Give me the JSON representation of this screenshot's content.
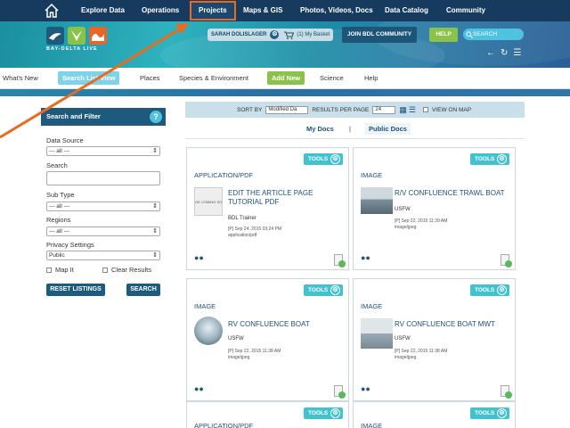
{
  "top_nav": {
    "items": [
      "Explore Data",
      "Operations",
      "Projects",
      "Maps & GIS",
      "Photos, Videos, Docs",
      "Data Catalog",
      "Community"
    ],
    "active": "Projects"
  },
  "header": {
    "logo_text": "BAY-DELTA LIVE",
    "user_name": "SARAH DOLISLAGER",
    "basket": "(1) My Basket",
    "community_button": "JOIN BDL COMMUNITY",
    "help_button": "HELP",
    "search_placeholder": "SEARCH"
  },
  "sub_nav": {
    "items": [
      "What's New",
      "Search List View",
      "Places",
      "Species & Environment",
      "Add New",
      "Science",
      "Help"
    ]
  },
  "sidebar": {
    "title": "Search and Filter",
    "help_glyph": "?",
    "data_source_label": "Data Source",
    "data_source_value": "--- all ---",
    "search_label": "Search",
    "search_value": "",
    "subtype_label": "Sub Type",
    "subtype_value": "--- all ---",
    "regions_label": "Regions",
    "regions_value": "--- all ---",
    "privacy_label": "Privacy Settings",
    "privacy_value": "Public",
    "map_it_label": "Map It",
    "clear_results_label": "Clear Results",
    "reset_button": "RESET LISTINGS",
    "search_button": "SEARCH"
  },
  "sortbar": {
    "sort_by_label": "SORT BY",
    "sort_value": "Modified Da",
    "per_page_label": "RESULTS PER PAGE",
    "per_page_value": "24",
    "view_on_map_label": "VIEW ON MAP"
  },
  "doc_tabs": {
    "my_docs": "My Docs",
    "separator": "|",
    "public_docs": "Public Docs"
  },
  "cards": [
    {
      "tools": "TOOLS",
      "type": "APPLICATION/PDF",
      "title": "EDIT THE ARTICLE PAGE TUTORIAL PDF",
      "thumb_text": "GE COMING SO",
      "org": "BDL Trainer",
      "date": "[P] Sep 24, 2015 03:24 PM",
      "mime": "application/pdf"
    },
    {
      "tools": "TOOLS",
      "type": "IMAGE",
      "title": "R/V CONFLUENCE TRAWL BOAT",
      "org": "USFW",
      "date": "[P] Sep 22, 2015 11:39 AM",
      "mime": "image/jpeg"
    },
    {
      "tools": "TOOLS",
      "type": "IMAGE",
      "title": "RV CONFLUENCE BOAT",
      "org": "USFW",
      "date": "[P] Sep 22, 2015 11:38 AM",
      "mime": "image/jpeg"
    },
    {
      "tools": "TOOLS",
      "type": "IMAGE",
      "title": "RV CONFLUENCE BOAT MWT",
      "org": "USFW",
      "date": "[P] Sep 22, 2015 11:38 AM",
      "mime": "image/jpeg"
    },
    {
      "tools": "TOOLS",
      "type": "APPLICATION/PDF"
    },
    {
      "tools": "TOOLS",
      "type": "IMAGE"
    }
  ],
  "colors": {
    "nav_bg": "#173b5e",
    "highlight": "#ea6b1d",
    "accent_teal": "#41c2cf",
    "accent_green": "#8bc34a",
    "link_blue": "#1d4f7a"
  }
}
